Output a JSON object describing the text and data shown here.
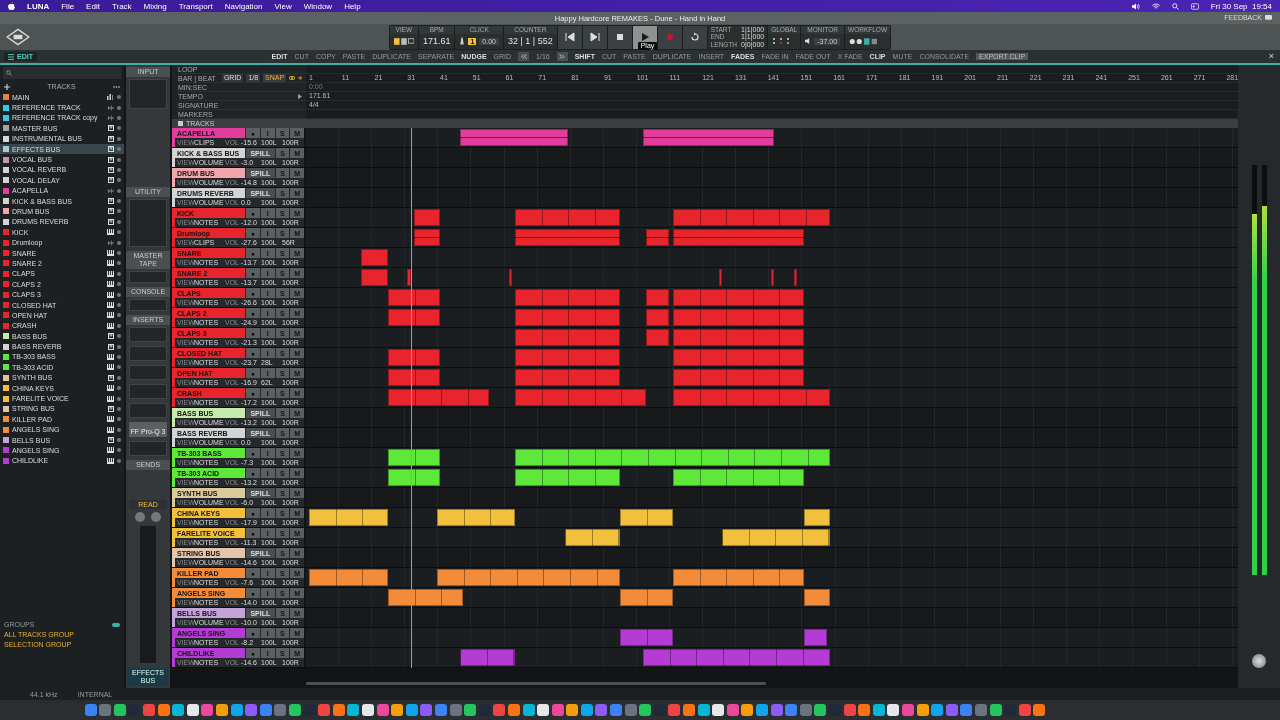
{
  "menu_bar": {
    "items": [
      "LUNA",
      "File",
      "Edit",
      "Track",
      "Mixing",
      "Transport",
      "Navigation",
      "View",
      "Window",
      "Help"
    ],
    "clock": "Fri 30 Sep  19:54"
  },
  "window": {
    "title": "Happy Hardcore REMAKES - Dune - Hand in Hand",
    "feedback": "FEEDBACK",
    "close": "×",
    "mode_tab": "EDIT"
  },
  "transport": {
    "view_label": "VIEW",
    "bpm_label": "BPM",
    "bpm": "171.61",
    "click_label": "CLICK",
    "click_count": "1",
    "click_level": "0.00",
    "counter_label": "COUNTER",
    "counter": "32 | 1 | 552",
    "buttons": [
      {
        "kind": "rewind",
        "selected": false
      },
      {
        "kind": "forward",
        "selected": false
      },
      {
        "kind": "stop",
        "selected": false
      },
      {
        "kind": "play",
        "selected": true
      },
      {
        "kind": "record",
        "selected": false
      },
      {
        "kind": "loop",
        "selected": false
      }
    ],
    "tooltip": "Play",
    "range": [
      {
        "label": "START",
        "value": "1|1|000"
      },
      {
        "label": "END",
        "value": "1|1|000"
      },
      {
        "label": "LENGTH",
        "value": "0|0|000"
      }
    ],
    "global_label": "GLOBAL",
    "monitor_label": "MONITOR",
    "monitor_level": "-37.00",
    "workflow_label": "WORKFLOW"
  },
  "toolbar": [
    {
      "kind": "group",
      "text": "EDIT"
    },
    {
      "kind": "action",
      "text": "CUT"
    },
    {
      "kind": "action",
      "text": "COPY"
    },
    {
      "kind": "action",
      "text": "PASTE"
    },
    {
      "kind": "action",
      "text": "DUPLICATE"
    },
    {
      "kind": "action",
      "text": "SEPARATE"
    },
    {
      "kind": "group",
      "text": "NUDGE"
    },
    {
      "kind": "action",
      "text": "GRID"
    },
    {
      "kind": "back"
    },
    {
      "kind": "action",
      "text": "1/16"
    },
    {
      "kind": "forward"
    },
    {
      "kind": "group",
      "text": "SHIFT"
    },
    {
      "kind": "action",
      "text": "CUT"
    },
    {
      "kind": "action",
      "text": "PASTE"
    },
    {
      "kind": "action",
      "text": "DUPLICATE"
    },
    {
      "kind": "action",
      "text": "INSERT"
    },
    {
      "kind": "group",
      "text": "FADES"
    },
    {
      "kind": "action",
      "text": "FADE IN"
    },
    {
      "kind": "action",
      "text": "FADE OUT"
    },
    {
      "kind": "action",
      "text": "X FADE"
    },
    {
      "kind": "group",
      "text": "CLIP"
    },
    {
      "kind": "action",
      "text": "MUTE"
    },
    {
      "kind": "action",
      "text": "CONSOLIDATE"
    },
    {
      "kind": "boxed",
      "text": "EXPORT CLIP"
    }
  ],
  "sidebar": {
    "title": "TRACKS",
    "tracks": [
      {
        "name": "MAIN",
        "color": "#e8843a",
        "kind": "output",
        "selected": false
      },
      {
        "name": "REFERENCE TRACK",
        "color": "#30cce4",
        "kind": "audio",
        "selected": false
      },
      {
        "name": "REFERENCE TRACK copy",
        "color": "#30cce4",
        "kind": "audio",
        "selected": false
      },
      {
        "name": "MASTER BUS",
        "color": "#a4a4a4",
        "kind": "bus",
        "selected": false
      },
      {
        "name": "INSTRUMENTAL BUS",
        "color": "#d8d8d8",
        "kind": "bus",
        "selected": false
      },
      {
        "name": "EFFECTS BUS",
        "color": "#a8ccd8",
        "kind": "bus",
        "selected": true
      },
      {
        "name": "VOCAL BUS",
        "color": "#c494b4",
        "kind": "bus",
        "selected": false
      },
      {
        "name": "VOCAL REVERB",
        "color": "#d4d4d4",
        "kind": "bus",
        "selected": false
      },
      {
        "name": "VOCAL DELAY",
        "color": "#d4d4d4",
        "kind": "bus",
        "selected": false
      },
      {
        "name": "ACAPELLA",
        "color": "#e23c9c",
        "kind": "audio",
        "selected": false
      },
      {
        "name": "KICK & BASS BUS",
        "color": "#d4d4d4",
        "kind": "bus",
        "selected": false
      },
      {
        "name": "DRUM BUS",
        "color": "#f2a6ac",
        "kind": "bus",
        "selected": false
      },
      {
        "name": "DRUMS REVERB",
        "color": "#d4d4d4",
        "kind": "bus",
        "selected": false
      },
      {
        "name": "KICK",
        "color": "#e8242c",
        "kind": "instrument",
        "selected": false
      },
      {
        "name": "Drumloop",
        "color": "#e8242c",
        "kind": "audio",
        "selected": false
      },
      {
        "name": "SNARE",
        "color": "#e8242c",
        "kind": "instrument",
        "selected": false
      },
      {
        "name": "SNARE 2",
        "color": "#e8242c",
        "kind": "instrument",
        "selected": false
      },
      {
        "name": "CLAPS",
        "color": "#e8242c",
        "kind": "instrument",
        "selected": false
      },
      {
        "name": "CLAPS 2",
        "color": "#e8242c",
        "kind": "instrument",
        "selected": false
      },
      {
        "name": "CLAPS 3",
        "color": "#e8242c",
        "kind": "instrument",
        "selected": false
      },
      {
        "name": "CLOSED HAT",
        "color": "#e8242c",
        "kind": "instrument",
        "selected": false
      },
      {
        "name": "OPEN HAT",
        "color": "#e8242c",
        "kind": "instrument",
        "selected": false
      },
      {
        "name": "CRASH",
        "color": "#e8242c",
        "kind": "instrument",
        "selected": false
      },
      {
        "name": "BASS BUS",
        "color": "#c6ecac",
        "kind": "bus",
        "selected": false
      },
      {
        "name": "BASS REVERB",
        "color": "#d4d4d4",
        "kind": "bus",
        "selected": false
      },
      {
        "name": "TB-303 BASS",
        "color": "#5ee83a",
        "kind": "instrument",
        "selected": false
      },
      {
        "name": "TB-303 ACID",
        "color": "#5ee83a",
        "kind": "instrument",
        "selected": false
      },
      {
        "name": "SYNTH BUS",
        "color": "#dcc99a",
        "kind": "bus",
        "selected": false
      },
      {
        "name": "CHINA KEYS",
        "color": "#f2c03c",
        "kind": "instrument",
        "selected": false
      },
      {
        "name": "FARELITE VOICE",
        "color": "#f2c03c",
        "kind": "instrument",
        "selected": false
      },
      {
        "name": "STRING BUS",
        "color": "#e4c4aa",
        "kind": "bus",
        "selected": false
      },
      {
        "name": "KILLER PAD",
        "color": "#f28c3a",
        "kind": "instrument",
        "selected": false
      },
      {
        "name": "ANGELS SING",
        "color": "#f28c3a",
        "kind": "instrument",
        "selected": false
      },
      {
        "name": "BELLS BUS",
        "color": "#c4a4d8",
        "kind": "bus",
        "selected": false
      },
      {
        "name": "ANGELS SING",
        "color": "#b43cd4",
        "kind": "instrument",
        "selected": false
      },
      {
        "name": "CHILDLIKE",
        "color": "#b43cd4",
        "kind": "instrument",
        "selected": false
      }
    ]
  },
  "mixer_strip": {
    "sections": [
      "INPUT",
      "UTILITY",
      "MASTER TAPE",
      "CONSOLE",
      "INSERTS",
      "SENDS"
    ],
    "plugin": "FF Pro-Q 3",
    "automation": "READ",
    "track": "EFFECTS BUS"
  },
  "groups": {
    "title": "GROUPS",
    "items": [
      "ALL TRACKS GROUP",
      "SELECTION GROUP"
    ]
  },
  "ruler": {
    "rows": [
      "LOOP",
      "BAR | BEAT",
      "MIN:SEC",
      "TEMPO",
      "SIGNATURE",
      "MARKERS"
    ],
    "grid_label": "GRID",
    "grid_value": "1/8",
    "snap": "SNAP",
    "bars": [
      "1",
      "11",
      "21",
      "31",
      "41",
      "51",
      "61",
      "71",
      "81",
      "91",
      "101",
      "111",
      "121",
      "131",
      "141",
      "151",
      "161",
      "171",
      "181",
      "191",
      "201",
      "211",
      "221",
      "231",
      "241",
      "251",
      "261",
      "271",
      "281"
    ],
    "min_sec": "0:00",
    "tempo": "171.61",
    "signature": "4/4"
  },
  "tracks_label": "TRACKS",
  "tracks": [
    {
      "name": "ACAPELLA",
      "color": "#e23c9c",
      "kind": "audio",
      "buttons": [
        "●",
        "I",
        "S",
        "M"
      ],
      "view_label": "VIEW",
      "view": "CLIPS",
      "vol_label": "VOL",
      "vol": "-15.6",
      "pan_l": "100L",
      "pan_r": "100R"
    },
    {
      "name": "KICK & BASS BUS",
      "color": "#d4d4d4",
      "kind": "bus",
      "buttons": [
        "SPILL",
        "S",
        "M"
      ],
      "view_label": "VIEW",
      "view": "VOLUME",
      "vol_label": "VOL",
      "vol": "-3.0",
      "pan_l": "100L",
      "pan_r": "100R"
    },
    {
      "name": "DRUM BUS",
      "color": "#f2a6ac",
      "kind": "bus",
      "buttons": [
        "SPILL",
        "S",
        "M"
      ],
      "view_label": "VIEW",
      "view": "VOLUME",
      "vol_label": "VOL",
      "vol": "-14.8",
      "pan_l": "100L",
      "pan_r": "100R"
    },
    {
      "name": "DRUMS REVERB",
      "color": "#d4d4d4",
      "kind": "bus",
      "buttons": [
        "SPILL",
        "S",
        "M"
      ],
      "view_label": "VIEW",
      "view": "VOLUME",
      "vol_label": "VOL",
      "vol": "0.0",
      "pan_l": "100L",
      "pan_r": "100R"
    },
    {
      "name": "KICK",
      "color": "#e8242c",
      "kind": "instrument",
      "buttons": [
        "●",
        "I",
        "S",
        "M"
      ],
      "view_label": "VIEW",
      "view": "NOTES",
      "vol_label": "VOL",
      "vol": "-12.0",
      "pan_l": "100L",
      "pan_r": "100R"
    },
    {
      "name": "Drumloop",
      "color": "#e8242c",
      "kind": "audio",
      "buttons": [
        "●",
        "I",
        "S",
        "M"
      ],
      "view_label": "VIEW",
      "view": "CLIPS",
      "vol_label": "VOL",
      "vol": "-27.6",
      "pan_l": "100L",
      "pan_r": "56R"
    },
    {
      "name": "SNARE",
      "color": "#e8242c",
      "kind": "instrument",
      "buttons": [
        "●",
        "I",
        "S",
        "M"
      ],
      "view_label": "VIEW",
      "view": "NOTES",
      "vol_label": "VOL",
      "vol": "-13.7",
      "pan_l": "100L",
      "pan_r": "100R"
    },
    {
      "name": "SNARE 2",
      "color": "#e8242c",
      "kind": "instrument",
      "buttons": [
        "●",
        "I",
        "S",
        "M"
      ],
      "view_label": "VIEW",
      "view": "NOTES",
      "vol_label": "VOL",
      "vol": "-13.7",
      "pan_l": "100L",
      "pan_r": "100R"
    },
    {
      "name": "CLAPS",
      "color": "#e8242c",
      "kind": "instrument",
      "buttons": [
        "●",
        "I",
        "S",
        "M"
      ],
      "view_label": "VIEW",
      "view": "NOTES",
      "vol_label": "VOL",
      "vol": "-26.6",
      "pan_l": "100L",
      "pan_r": "100R"
    },
    {
      "name": "CLAPS 2",
      "color": "#e8242c",
      "kind": "instrument",
      "buttons": [
        "●",
        "I",
        "S",
        "M"
      ],
      "view_label": "VIEW",
      "view": "NOTES",
      "vol_label": "VOL",
      "vol": "-24.9",
      "pan_l": "100L",
      "pan_r": "100R"
    },
    {
      "name": "CLAPS 3",
      "color": "#e8242c",
      "kind": "instrument",
      "buttons": [
        "●",
        "I",
        "S",
        "M"
      ],
      "view_label": "VIEW",
      "view": "NOTES",
      "vol_label": "VOL",
      "vol": "-21.3",
      "pan_l": "100L",
      "pan_r": "100R"
    },
    {
      "name": "CLOSED HAT",
      "color": "#e8242c",
      "kind": "instrument",
      "buttons": [
        "●",
        "I",
        "S",
        "M"
      ],
      "view_label": "VIEW",
      "view": "NOTES",
      "vol_label": "VOL",
      "vol": "-23.7",
      "pan_l": "28L",
      "pan_r": "100R"
    },
    {
      "name": "OPEN HAT",
      "color": "#e8242c",
      "kind": "instrument",
      "buttons": [
        "●",
        "I",
        "S",
        "M"
      ],
      "view_label": "VIEW",
      "view": "NOTES",
      "vol_label": "VOL",
      "vol": "-16.9",
      "pan_l": "62L",
      "pan_r": "100R"
    },
    {
      "name": "CRASH",
      "color": "#e8242c",
      "kind": "instrument",
      "buttons": [
        "●",
        "I",
        "S",
        "M"
      ],
      "view_label": "VIEW",
      "view": "NOTES",
      "vol_label": "VOL",
      "vol": "-17.2",
      "pan_l": "100L",
      "pan_r": "100R"
    },
    {
      "name": "BASS BUS",
      "color": "#c6ecac",
      "kind": "bus",
      "buttons": [
        "SPILL",
        "S",
        "M"
      ],
      "view_label": "VIEW",
      "view": "VOLUME",
      "vol_label": "VOL",
      "vol": "-13.2",
      "pan_l": "100L",
      "pan_r": "100R"
    },
    {
      "name": "BASS REVERB",
      "color": "#d4d4d4",
      "kind": "bus",
      "buttons": [
        "SPILL",
        "S",
        "M"
      ],
      "view_label": "VIEW",
      "view": "VOLUME",
      "vol_label": "VOL",
      "vol": "0.0",
      "pan_l": "100L",
      "pan_r": "100R"
    },
    {
      "name": "TB-303 BASS",
      "color": "#5ee83a",
      "kind": "instrument",
      "buttons": [
        "●",
        "I",
        "S",
        "M"
      ],
      "view_label": "VIEW",
      "view": "NOTES",
      "vol_label": "VOL",
      "vol": "-7.3",
      "pan_l": "100L",
      "pan_r": "100R"
    },
    {
      "name": "TB-303 ACID",
      "color": "#5ee83a",
      "kind": "instrument",
      "buttons": [
        "●",
        "I",
        "S",
        "M"
      ],
      "view_label": "VIEW",
      "view": "NOTES",
      "vol_label": "VOL",
      "vol": "-13.2",
      "pan_l": "100L",
      "pan_r": "100R"
    },
    {
      "name": "SYNTH BUS",
      "color": "#dcc99a",
      "kind": "bus",
      "buttons": [
        "SPILL",
        "S",
        "M"
      ],
      "view_label": "VIEW",
      "view": "VOLUME",
      "vol_label": "VOL",
      "vol": "-6.0",
      "pan_l": "100L",
      "pan_r": "100R"
    },
    {
      "name": "CHINA KEYS",
      "color": "#f2c03c",
      "kind": "instrument",
      "buttons": [
        "●",
        "I",
        "S",
        "M"
      ],
      "view_label": "VIEW",
      "view": "NOTES",
      "vol_label": "VOL",
      "vol": "-17.9",
      "pan_l": "100L",
      "pan_r": "100R"
    },
    {
      "name": "FARELITE VOICE",
      "color": "#f2c03c",
      "kind": "instrument",
      "buttons": [
        "●",
        "I",
        "S",
        "M"
      ],
      "view_label": "VIEW",
      "view": "NOTES",
      "vol_label": "VOL",
      "vol": "-11.3",
      "pan_l": "100L",
      "pan_r": "100R"
    },
    {
      "name": "STRING BUS",
      "color": "#e4c4aa",
      "kind": "bus",
      "buttons": [
        "SPILL",
        "S",
        "M"
      ],
      "view_label": "VIEW",
      "view": "VOLUME",
      "vol_label": "VOL",
      "vol": "-14.6",
      "pan_l": "100L",
      "pan_r": "100R"
    },
    {
      "name": "KILLER PAD",
      "color": "#f28c3a",
      "kind": "instrument",
      "buttons": [
        "●",
        "I",
        "S",
        "M"
      ],
      "view_label": "VIEW",
      "view": "NOTES",
      "vol_label": "VOL",
      "vol": "-7.6",
      "pan_l": "100L",
      "pan_r": "100R"
    },
    {
      "name": "ANGELS SING",
      "color": "#f28c3a",
      "kind": "instrument",
      "buttons": [
        "●",
        "I",
        "S",
        "M"
      ],
      "view_label": "VIEW",
      "view": "NOTES",
      "vol_label": "VOL",
      "vol": "-14.0",
      "pan_l": "100L",
      "pan_r": "100R"
    },
    {
      "name": "BELLS BUS",
      "color": "#c4a4d8",
      "kind": "bus",
      "buttons": [
        "SPILL",
        "S",
        "M"
      ],
      "view_label": "VIEW",
      "view": "VOLUME",
      "vol_label": "VOL",
      "vol": "-10.0",
      "pan_l": "100L",
      "pan_r": "100R"
    },
    {
      "name": "ANGELS SING",
      "color": "#b43cd4",
      "kind": "instrument",
      "buttons": [
        "●",
        "I",
        "S",
        "M"
      ],
      "view_label": "VIEW",
      "view": "NOTES",
      "vol_label": "VOL",
      "vol": "-8.2",
      "pan_l": "100L",
      "pan_r": "100R"
    },
    {
      "name": "CHILDLIKE",
      "color": "#b43cd4",
      "kind": "instrument",
      "buttons": [
        "●",
        "I",
        "S",
        "M"
      ],
      "view_label": "VIEW",
      "view": "NOTES",
      "vol_label": "VOL",
      "vol": "-14.6",
      "pan_l": "100L",
      "pan_r": "100R"
    }
  ],
  "output_meters": [
    {
      "level": 0.88
    },
    {
      "level": 0.9
    }
  ],
  "status": {
    "sample_rate": "44.1 kHz",
    "clock_source": "INTERNAL"
  }
}
